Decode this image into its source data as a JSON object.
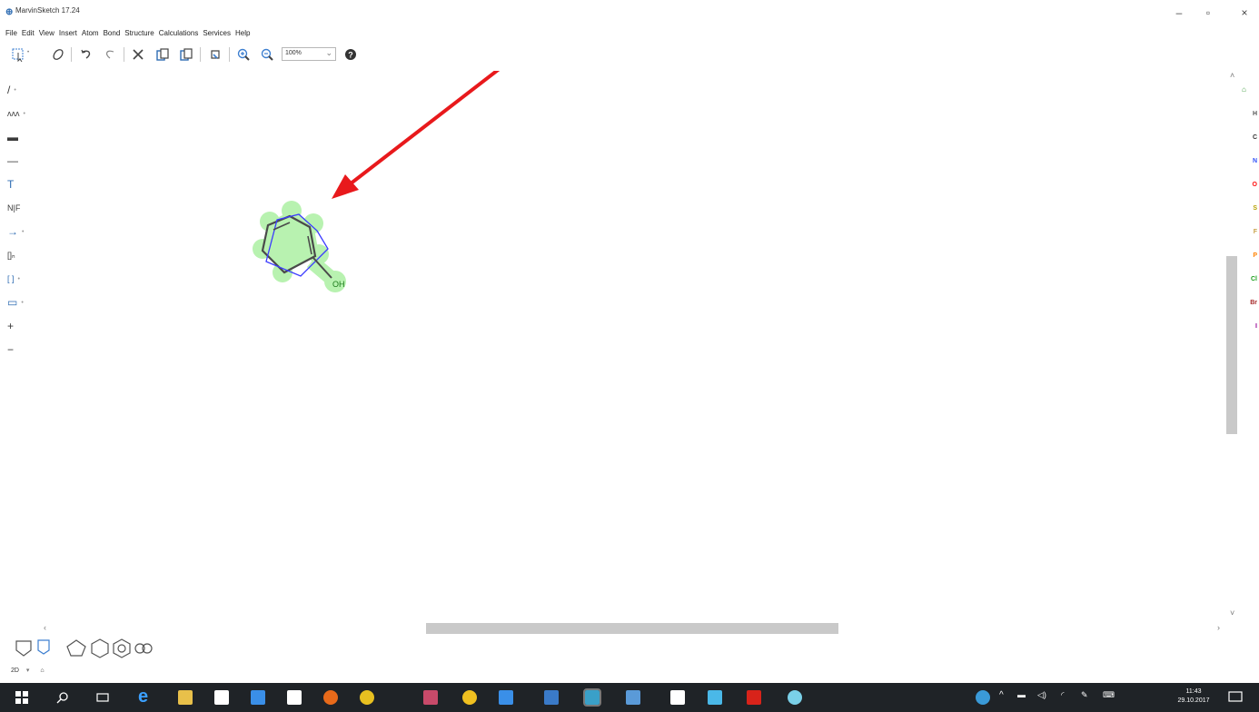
{
  "window": {
    "title": "MarvinSketch 17.24"
  },
  "menu": [
    "File",
    "Edit",
    "View",
    "Insert",
    "Atom",
    "Bond",
    "Structure",
    "Calculations",
    "Services",
    "Help"
  ],
  "toolbar": {
    "zoom": "100%"
  },
  "left_tools": [
    {
      "icon": "single-bond-icon",
      "glyph": "/",
      "dropdown": true
    },
    {
      "icon": "chain-icon",
      "glyph": "ʌʌʌ",
      "dropdown": true
    },
    {
      "icon": "bold-bond-icon",
      "glyph": "▬",
      "dropdown": false
    },
    {
      "icon": "hashed-bond-icon",
      "glyph": "—",
      "dropdown": false
    },
    {
      "icon": "text-icon",
      "glyph": "T",
      "dropdown": false
    },
    {
      "icon": "atom-list-icon",
      "glyph": "N|F",
      "dropdown": false
    },
    {
      "icon": "reaction-arrow-icon",
      "glyph": "→",
      "dropdown": true
    },
    {
      "icon": "sgroup-bracket-icon",
      "glyph": "[]ₙ",
      "dropdown": false
    },
    {
      "icon": "bracket-icon",
      "glyph": "[ ]",
      "dropdown": true
    },
    {
      "icon": "rectangle-icon",
      "glyph": "▭",
      "dropdown": true
    },
    {
      "icon": "positive-charge-icon",
      "glyph": "+",
      "dropdown": false
    },
    {
      "icon": "negative-charge-icon",
      "glyph": "−",
      "dropdown": false
    }
  ],
  "elements": [
    {
      "symbol": "H",
      "color": "#555555"
    },
    {
      "symbol": "C",
      "color": "#333333"
    },
    {
      "symbol": "N",
      "color": "#3050f8"
    },
    {
      "symbol": "O",
      "color": "#ff0d0d"
    },
    {
      "symbol": "S",
      "color": "#b5a000"
    },
    {
      "symbol": "F",
      "color": "#c9a24a"
    },
    {
      "symbol": "P",
      "color": "#ff8000"
    },
    {
      "symbol": "Cl",
      "color": "#1fa01f"
    },
    {
      "symbol": "Br",
      "color": "#a62929"
    },
    {
      "symbol": "I",
      "color": "#940094"
    }
  ],
  "canvas": {
    "hydroxyl_label": "OH"
  },
  "status": {
    "mode": "2D"
  },
  "taskbar": {
    "time": "11:43",
    "date": "29.10.2017"
  }
}
